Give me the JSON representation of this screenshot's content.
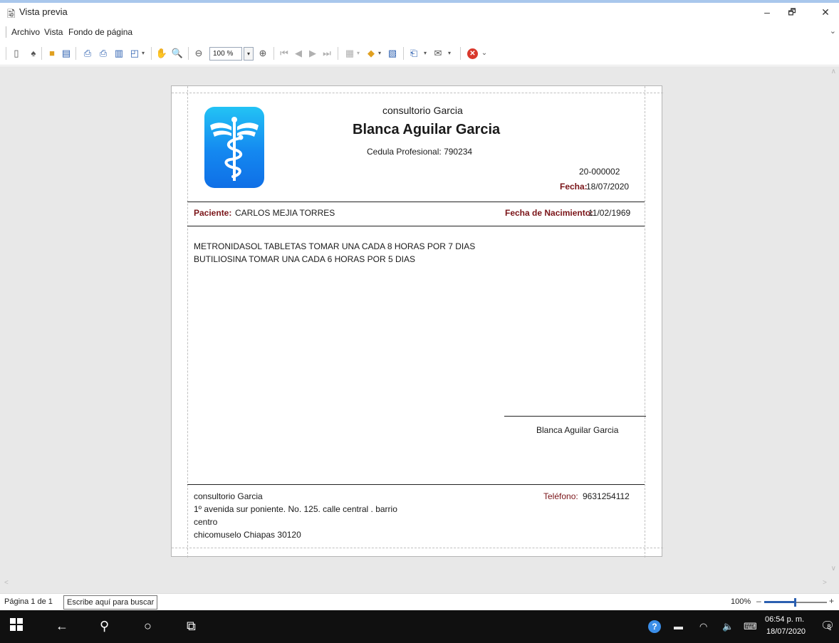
{
  "window": {
    "title": "Vista previa",
    "app_icon": "document-preview-icon",
    "minimize": "–",
    "restore": "🗗",
    "close": "✕"
  },
  "menu": {
    "items": [
      "Archivo",
      "Vista",
      "Fondo de página"
    ],
    "collapse": "⌄"
  },
  "toolbar": {
    "zoom_value": "100 %",
    "zoom_dropdown": "▾"
  },
  "prescription": {
    "clinic": "consultorio Garcia",
    "doctor": "Blanca Aguilar Garcia",
    "license": "Cedula Profesional: 790234",
    "folio": "20-000002",
    "date_label": "Fecha:",
    "date_value": "18/07/2020",
    "patient_label": "Paciente:",
    "patient_value": "CARLOS MEJIA TORRES",
    "birth_label": "Fecha de Nacimiento:",
    "birth_value": "11/02/1969",
    "lines": [
      "METRONIDASOL TABLETAS TOMAR UNA CADA 8 HORAS POR 7 DIAS",
      "BUTILIOSINA TOMAR UNA CADA 6 HORAS POR 5 DIAS"
    ],
    "signature_name": "Blanca Aguilar Garcia",
    "footer": {
      "clinic": "consultorio Garcia",
      "address_1": "1º avenida sur poniente. No. 125. calle central . barrio",
      "address_2": "centro",
      "city": "chicomuselo Chiapas 30120",
      "phone_label": "Teléfono:",
      "phone_value": "9631254112"
    },
    "logo_color_top": "#23c3f5",
    "logo_color_bottom": "#0f6fe6",
    "accent_color": "#7a1418"
  },
  "statusbar": {
    "page_info": "Página 1 de 1",
    "search_tooltip": "Escribe aquí para buscar",
    "zoom_percent": "100%",
    "zoom_minus": "–",
    "zoom_plus": "+",
    "zoom_level": 0.5
  },
  "taskbar": {
    "time": "06:54 p. m.",
    "date": "18/07/2020",
    "notifications": "8"
  }
}
